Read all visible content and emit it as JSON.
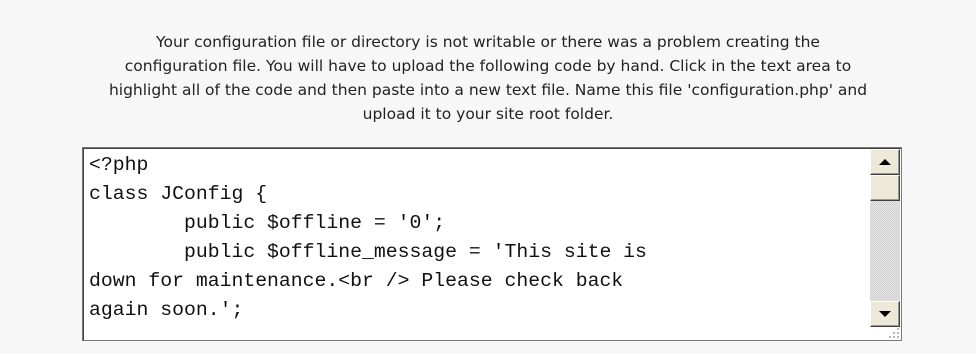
{
  "message": {
    "lines": [
      "Your configuration file or directory is not writable or there was a problem creating the",
      "configuration file. You will have to upload the following code by hand. Click in the text area to",
      "highlight all of the code and then paste into a new text file. Name this file 'configuration.php' and",
      "upload it to your site root folder."
    ]
  },
  "code": {
    "lines": [
      "<?php",
      "class JConfig {",
      "        public $offline = '0';",
      "        public $offline_message = 'This site is",
      "down for maintenance.<br /> Please check back",
      "again soon.';"
    ]
  },
  "scrollbar": {
    "up_icon": "arrow-up-icon",
    "down_icon": "arrow-down-icon",
    "position": 0
  }
}
